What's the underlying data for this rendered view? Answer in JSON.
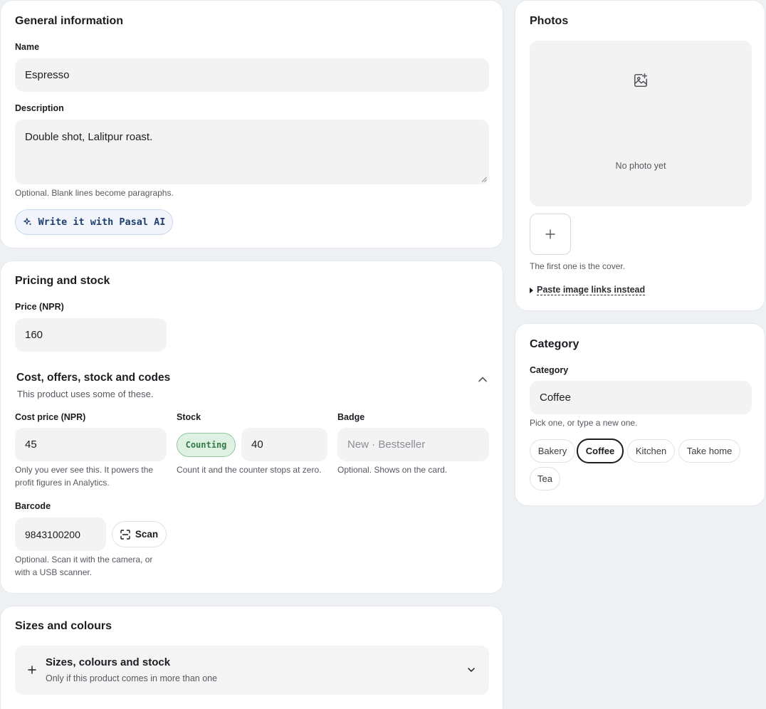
{
  "general": {
    "title": "General information",
    "name_label": "Name",
    "name_value": "Espresso",
    "description_label": "Description",
    "description_value": "Double shot, Lalitpur roast.",
    "description_hint": "Optional. Blank lines become paragraphs.",
    "ai_button_label": "Write it with Pasal AI"
  },
  "pricing": {
    "title": "Pricing and stock",
    "price_label": "Price (NPR)",
    "price_value": "160",
    "section_title": "Cost, offers, stock and codes",
    "section_subtitle": "This product uses some of these.",
    "cost_label": "Cost price (NPR)",
    "cost_value": "45",
    "cost_hint": "Only you ever see this. It powers the profit figures in Analytics.",
    "stock_label": "Stock",
    "stock_toggle": "Counting",
    "stock_value": "40",
    "stock_hint": "Count it and the counter stops at zero.",
    "badge_label": "Badge",
    "badge_placeholder": "New · Bestseller",
    "badge_hint": "Optional. Shows on the card.",
    "barcode_label": "Barcode",
    "barcode_value": "9843100200",
    "scan_label": "Scan",
    "barcode_hint": "Optional. Scan it with the camera, or with a USB scanner."
  },
  "sizes": {
    "title": "Sizes and colours",
    "row_title": "Sizes, colours and stock",
    "row_subtitle": "Only if this product comes in more than one"
  },
  "photos": {
    "title": "Photos",
    "empty_text": "No photo yet",
    "cover_hint": "The first one is the cover.",
    "paste_link": "Paste image links instead"
  },
  "category": {
    "title": "Category",
    "field_label": "Category",
    "field_value": "Coffee",
    "hint": "Pick one, or type a new one.",
    "chips": [
      "Bakery",
      "Coffee",
      "Kitchen",
      "Take home",
      "Tea"
    ],
    "selected": "Coffee"
  },
  "colors": {
    "accent_green_bg": "#dff1e3",
    "accent_green_text": "#2f7a46",
    "ai_border": "#c9d6e8"
  }
}
